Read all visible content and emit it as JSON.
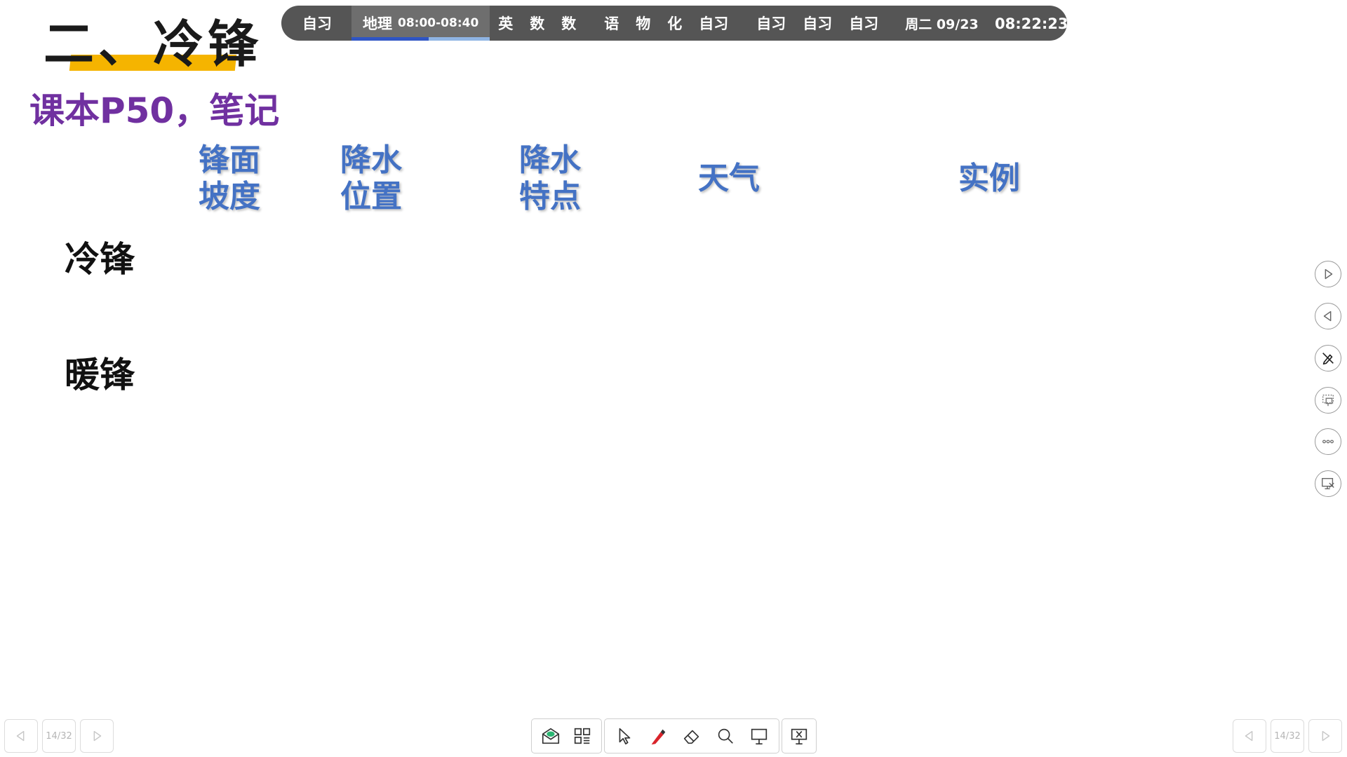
{
  "slide": {
    "title": "二、冷锋",
    "subtitle": "课本P50，笔记",
    "columns": [
      {
        "line1": "锋面",
        "line2": "坡度"
      },
      {
        "line1": "降水",
        "line2": "位置"
      },
      {
        "line1": "降水",
        "line2": "特点"
      },
      {
        "line1": "天气",
        "line2": ""
      },
      {
        "line1": "实例",
        "line2": ""
      }
    ],
    "rows": [
      "冷锋",
      "暖锋"
    ]
  },
  "schedule": {
    "periods_a": [
      "自习"
    ],
    "current": {
      "subject": "地理",
      "time": "08:00-08:40",
      "progress": 0.56
    },
    "periods_b": [
      "英",
      "数",
      "数"
    ],
    "periods_c": [
      "语",
      "物",
      "化",
      "自习"
    ],
    "periods_d": [
      "自习",
      "自习",
      "自习"
    ],
    "date": "周二 09/23",
    "time": "08:22:23"
  },
  "side_tools": [
    "play-icon",
    "back-icon",
    "pen-disabled-icon",
    "screen-select-icon",
    "more-icon",
    "exit-screen-icon"
  ],
  "pager": {
    "left": "14/32",
    "right": "14/32"
  },
  "toolbar": [
    "mail-icon",
    "grid-icon",
    "cursor-icon",
    "pen-icon",
    "eraser-icon",
    "search-icon",
    "whiteboard-icon",
    "close-presentation-icon"
  ],
  "colors": {
    "title_bar": "#f5b400",
    "subtitle": "#7030a0",
    "header": "#4472c4",
    "schedule_bg": "#555555",
    "progress": "#2f55c4",
    "pen": "#d9232a"
  }
}
